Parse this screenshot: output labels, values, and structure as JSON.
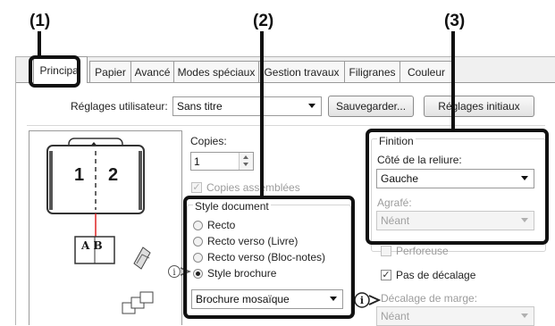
{
  "callouts": [
    "(1)",
    "(2)",
    "(3)"
  ],
  "tabs": [
    "Principal",
    "Papier",
    "Avancé",
    "Modes spéciaux",
    "Gestion travaux",
    "Filigranes",
    "Couleur"
  ],
  "user_settings": {
    "label": "Réglages utilisateur:",
    "value": "Sans titre",
    "save_button": "Sauvegarder...",
    "defaults_button": "Réglages initiaux"
  },
  "preview": {
    "page_left": "1",
    "page_right": "2",
    "booklet_text": "A B"
  },
  "copies": {
    "label": "Copies:",
    "value": "1",
    "collate_label": "Copies assemblées",
    "collate_checked": true
  },
  "document_style": {
    "title": "Style document",
    "options": [
      "Recto",
      "Recto verso (Livre)",
      "Recto verso (Bloc-notes)",
      "Style brochure"
    ],
    "selected": "Style brochure",
    "brochure_value": "Brochure mosaïque"
  },
  "finishing": {
    "title": "Finition",
    "binding_label": "Côté de la reliure:",
    "binding_value": "Gauche",
    "staple_label": "Agrafé:",
    "staple_value": "Néant",
    "punch_label": "Perforeuse",
    "no_offset_label": "Pas de décalage",
    "no_offset_checked": true,
    "margin_shift_label": "Décalage de marge:",
    "margin_shift_value": "Néant"
  },
  "colors": {
    "highlight": "#111111",
    "dialog_bg": "#f0f0f0",
    "panel_bg": "#ffffff"
  }
}
